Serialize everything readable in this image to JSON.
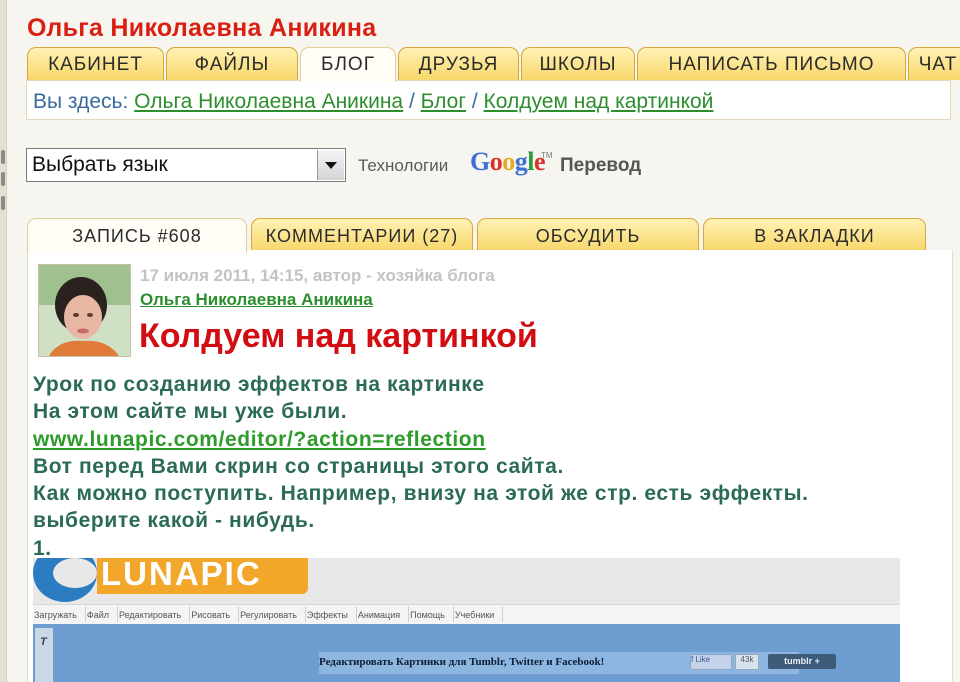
{
  "profile": {
    "name": "Ольга Николаевна Аникина"
  },
  "nav": {
    "tabs": [
      {
        "label": "КАБИНЕТ"
      },
      {
        "label": "ФАЙЛЫ"
      },
      {
        "label": "БЛОГ",
        "active": true
      },
      {
        "label": "ДРУЗЬЯ"
      },
      {
        "label": "ШКОЛЫ"
      },
      {
        "label": "НАПИСАТЬ ПИСЬМО"
      },
      {
        "label": "ЧАТ"
      }
    ]
  },
  "breadcrumb": {
    "prefix": "Вы здесь:",
    "items": [
      "Ольга Николаевна Аникина",
      "Блог",
      "Колдуем над картинкой"
    ],
    "separator": "/"
  },
  "translate": {
    "select_value": "Выбрать язык",
    "powered": "Технологии",
    "brand_letters": [
      {
        "ch": "G",
        "color": "#3d6fd8"
      },
      {
        "ch": "o",
        "color": "#d8352a"
      },
      {
        "ch": "o",
        "color": "#e6a920"
      },
      {
        "ch": "g",
        "color": "#3d6fd8"
      },
      {
        "ch": "l",
        "color": "#2d9b3a"
      },
      {
        "ch": "e",
        "color": "#d8352a"
      }
    ],
    "brand_tm": "TM",
    "service": "Перевод"
  },
  "post_tabs": [
    {
      "label": "ЗАПИСЬ #608",
      "active": true
    },
    {
      "label": "КОММЕНТАРИИ (27)"
    },
    {
      "label": "ОБСУДИТЬ"
    },
    {
      "label": "В ЗАКЛАДКИ"
    }
  ],
  "post": {
    "meta": "17 июля 2011, 14:15, автор - хозяйка блога",
    "author": "Ольга Николаевна Аникина",
    "title": "Колдуем над картинкой",
    "lines": [
      "Урок по созданию эффектов на картинке",
      "На этом сайте мы уже были.",
      "Вот перед Вами скрин со страницы этого сайта.",
      "Как можно поступить. Например, внизу на этой же стр. есть эффекты.",
      "выберите какой - нибудь.",
      "1."
    ],
    "link": "www.lunapic.com/editor/?action=reflection"
  },
  "embedded": {
    "logo": "LUNAPIC",
    "menu": [
      "Загружать",
      "Файл",
      "Редактировать",
      "Рисовать",
      "Регулировать",
      "Эффекты",
      "Анимация",
      "Помощь",
      "Учебники"
    ],
    "tool_letter": "T",
    "headline": "Редактировать Картинки для Tumblr, Twitter и Facebook!",
    "fb_label": "f Like",
    "count": "43k",
    "tumblr": "tumblr +"
  },
  "colors": {
    "name_red": "#d91e12",
    "link_green": "#2d8e2e",
    "tab_gold": "#f8d76a",
    "body_text": "#2b6b55"
  }
}
